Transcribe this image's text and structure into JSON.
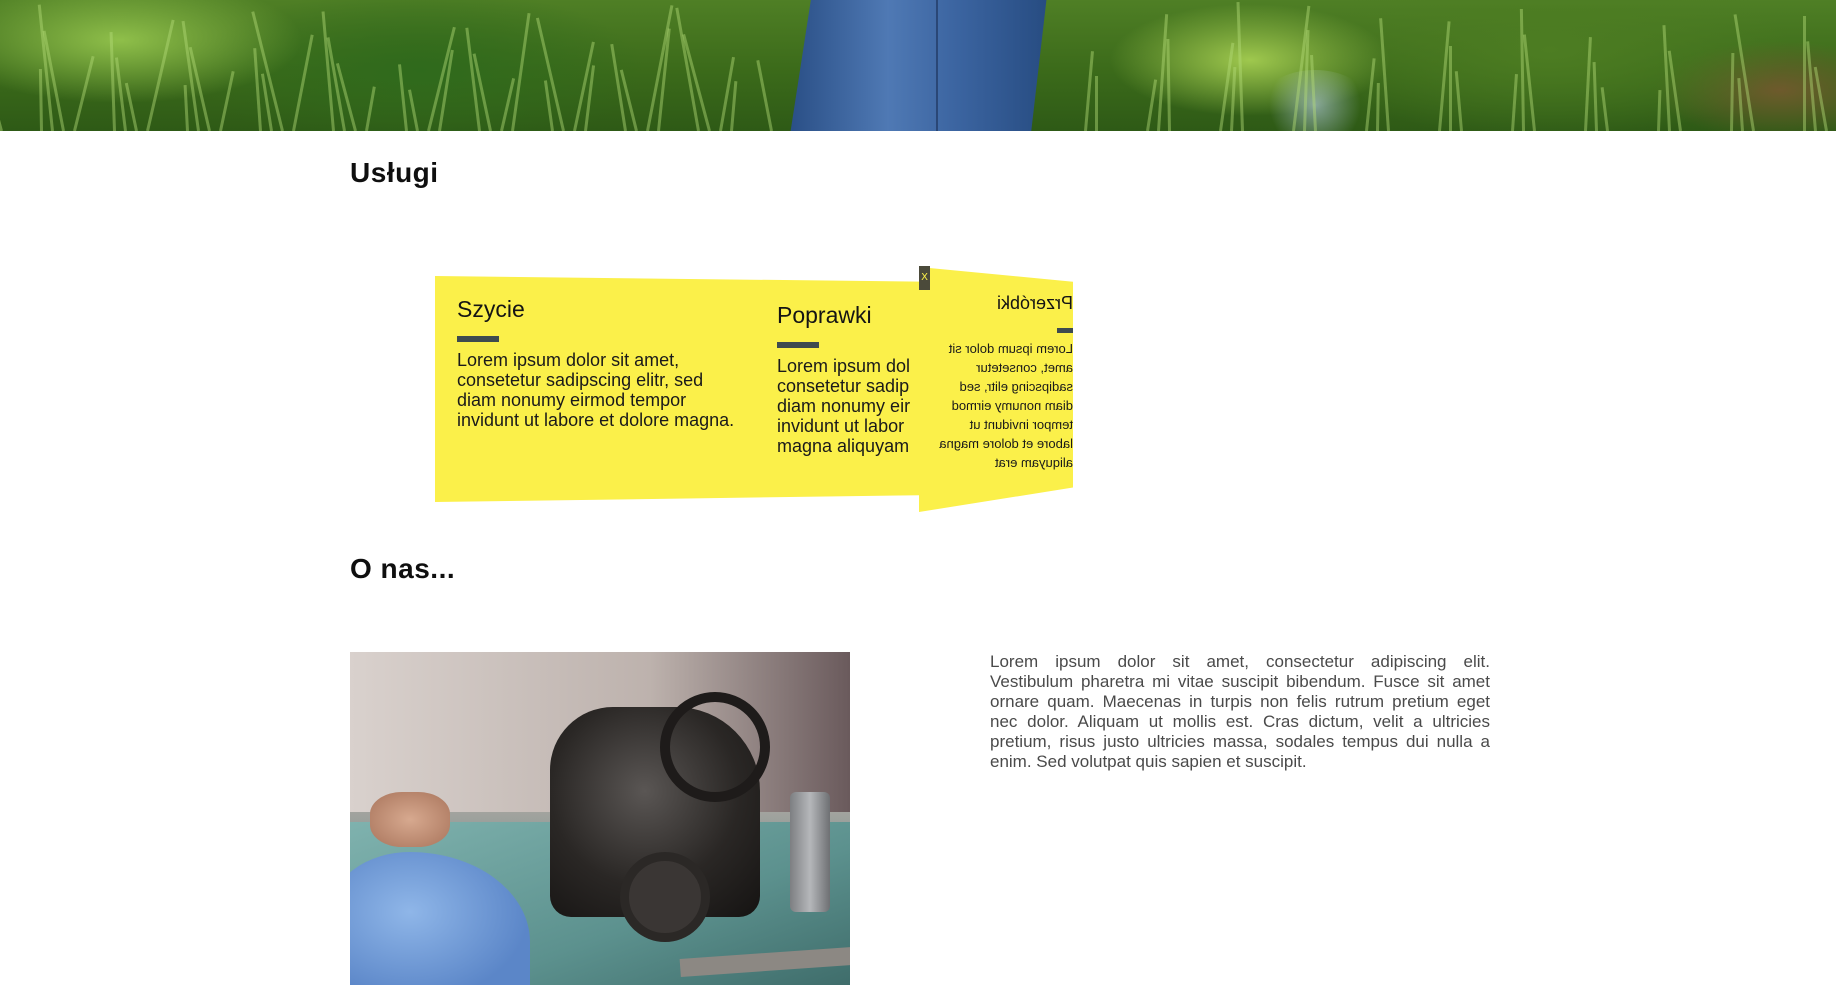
{
  "sections": {
    "services_heading": "Usługi",
    "about_heading": "O nas..."
  },
  "services": [
    {
      "title": "Szycie",
      "text": "Lorem ipsum dolor sit amet, consetetur sadipscing elitr, sed diam nonumy eirmod tempor invidunt ut labore et dolore magna."
    },
    {
      "title": "Poprawki",
      "lines": [
        "Lorem ipsum dol",
        "consetetur sadip",
        "diam nonumy eir",
        "invidunt ut labor",
        "magna aliquyam"
      ]
    },
    {
      "title": "Przeróbki",
      "text": "Lorem ipsum dolor sit amet, consetetur sadipscing elitr, sed diam nonumy eirmod tempor invidunt ut labore et dolore magna aliquyam erat"
    }
  ],
  "close_label": "X",
  "about": {
    "text": "Lorem ipsum dolor sit amet, consectetur adipiscing elit. Vestibulum pharetra mi vitae suscipit bibendum. Fusce sit amet ornare quam. Maecenas in turpis non felis rutrum pretium eget nec dolor. Aliquam ut mollis est. Cras dictum, velit a ultricies pretium, risus justo ultricies massa, sodales tempus dui nulla a enim. Sed volutpat quis sapien et suscipit."
  },
  "colors": {
    "card_yellow": "#fbf04a",
    "accent_bar": "#3e4b4f",
    "heading": "#0f0f0f"
  }
}
